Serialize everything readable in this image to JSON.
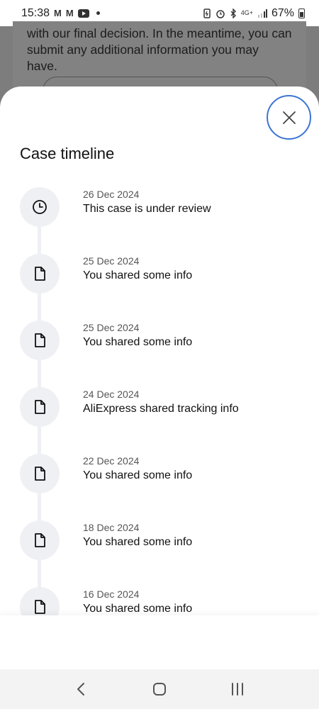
{
  "status_bar": {
    "time": "15:38",
    "gmail_glyph": "M",
    "network": "4G+",
    "battery": "67%",
    "icons": [
      "gmail-icon",
      "gmail-icon",
      "youtube-icon",
      "dot-icon",
      "battery-saver-icon",
      "alarm-icon",
      "bluetooth-icon",
      "network-icon",
      "signal-icon",
      "battery-icon"
    ]
  },
  "background": {
    "text": "with our final decision. In the meantime, you can submit any additional information you may have."
  },
  "sheet": {
    "title": "Case timeline",
    "close_icon": "close-icon",
    "items": [
      {
        "date": "26 Dec 2024",
        "text": "This case is under review",
        "icon": "clock-icon"
      },
      {
        "date": "25 Dec 2024",
        "text": "You shared some info",
        "icon": "document-icon"
      },
      {
        "date": "25 Dec 2024",
        "text": "You shared some info",
        "icon": "document-icon"
      },
      {
        "date": "24 Dec 2024",
        "text": "AliExpress shared tracking info",
        "icon": "document-icon"
      },
      {
        "date": "22 Dec 2024",
        "text": "You shared some info",
        "icon": "document-icon"
      },
      {
        "date": "18 Dec 2024",
        "text": "You shared some info",
        "icon": "document-icon"
      },
      {
        "date": "16 Dec 2024",
        "text": "You shared some info",
        "icon": "document-icon"
      }
    ]
  },
  "nav_bar": {
    "icons": [
      "back-icon",
      "home-icon",
      "recents-icon"
    ]
  },
  "colors": {
    "accent": "#3b74d4",
    "icon_bg": "#eef0f3",
    "scrim": "#7d7d7d"
  }
}
